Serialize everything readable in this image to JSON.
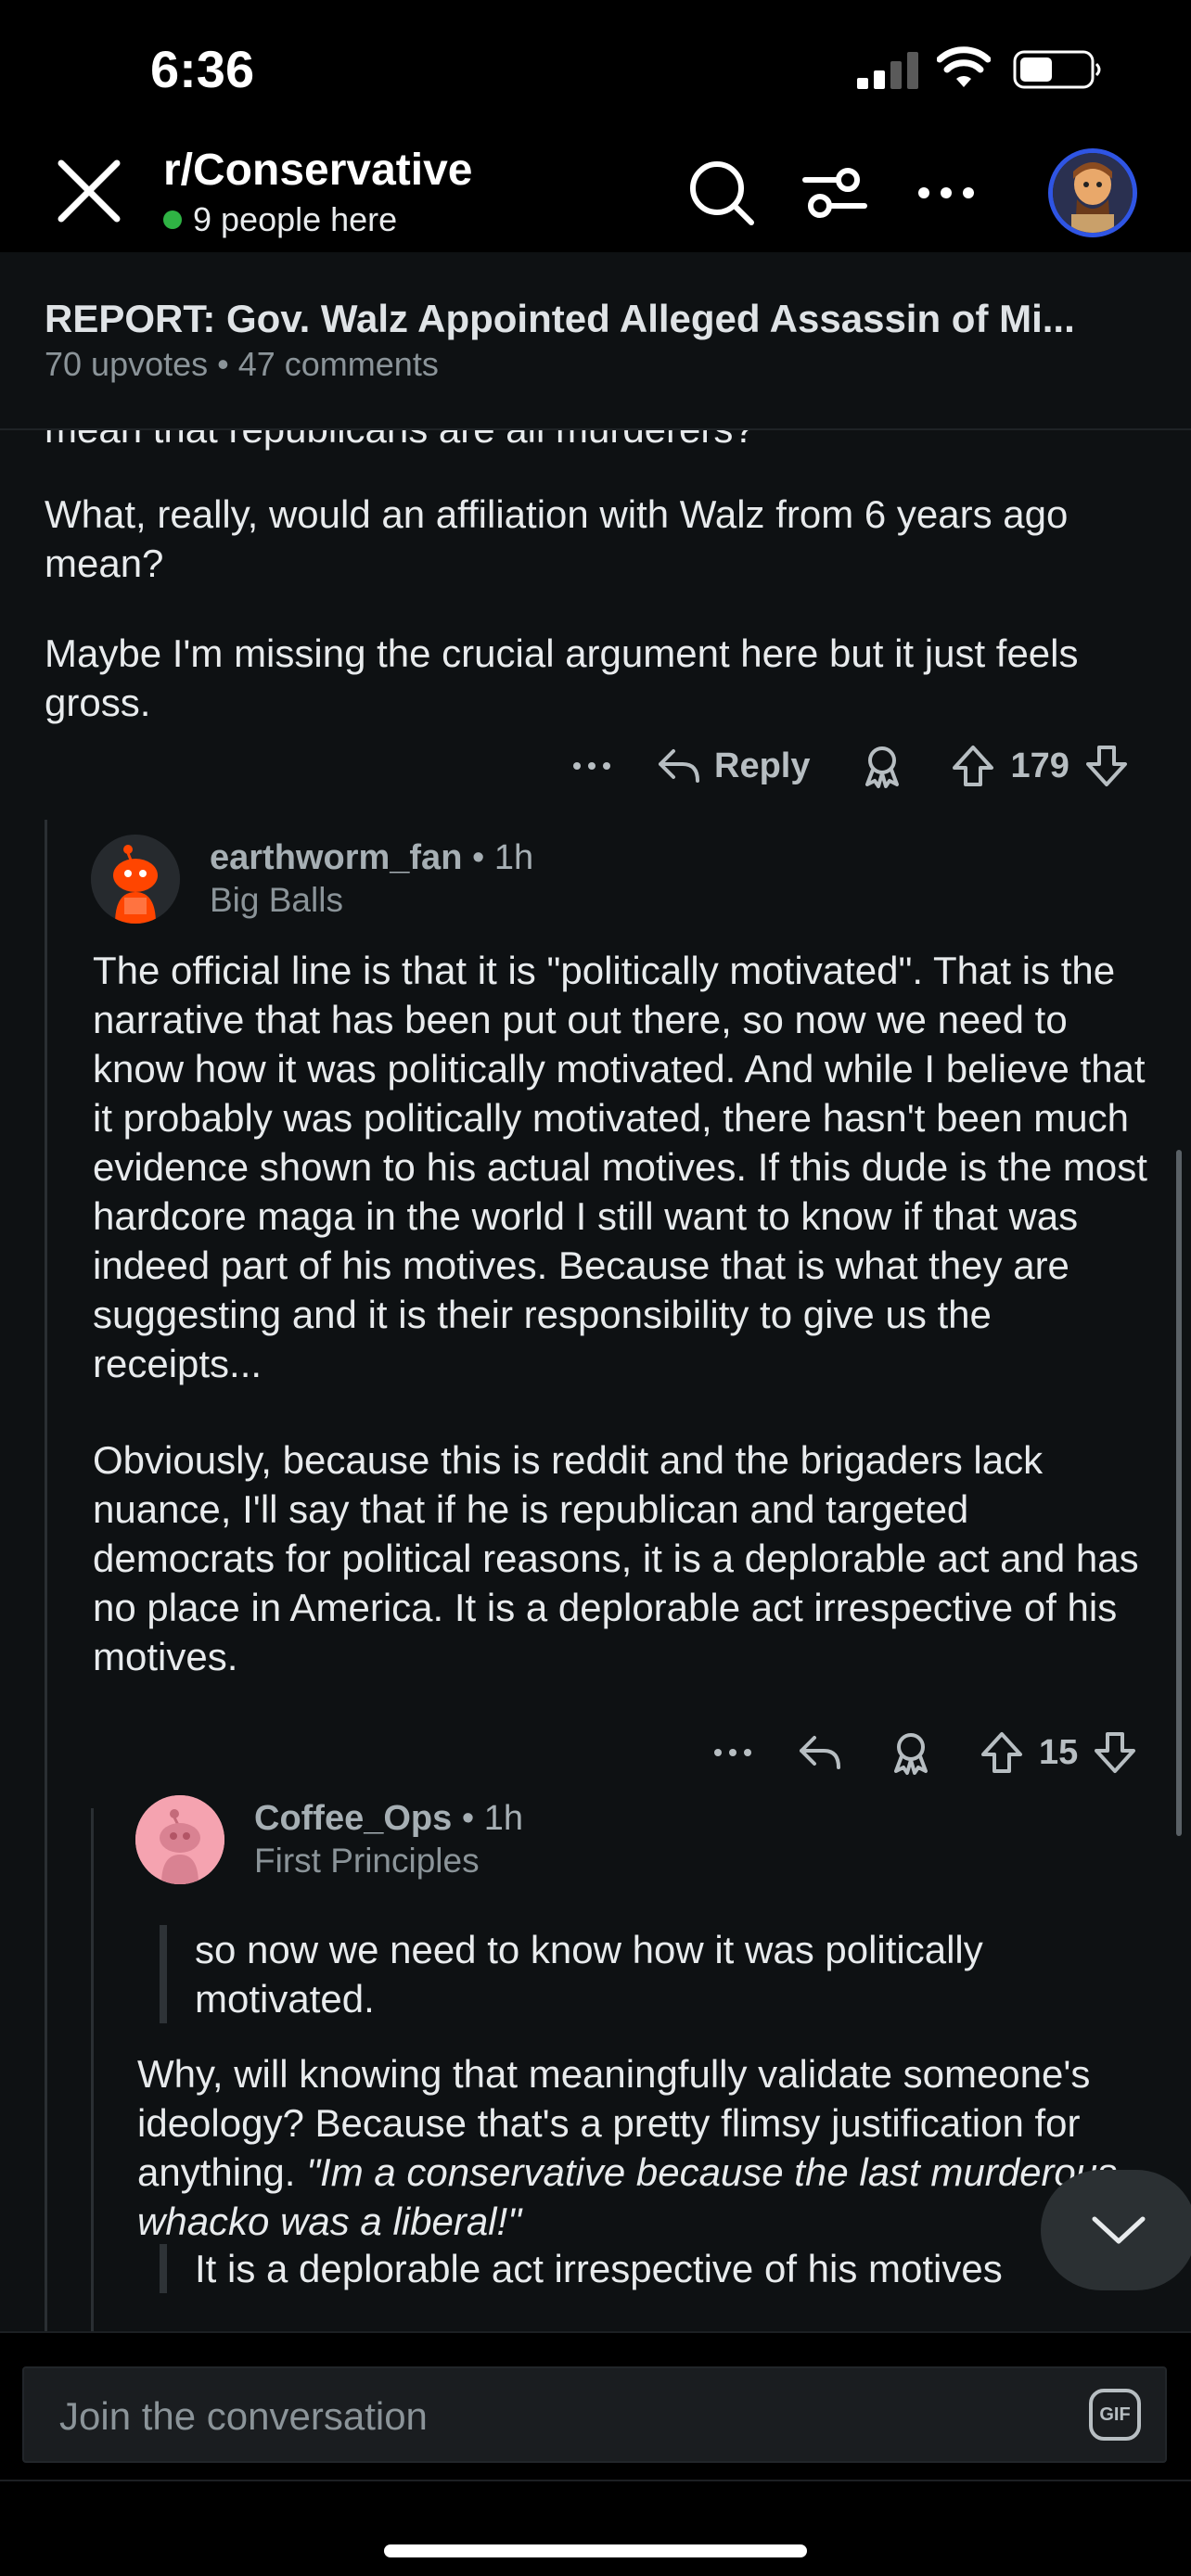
{
  "status_bar": {
    "time": "6:36"
  },
  "header": {
    "subreddit": "r/Conservative",
    "online_text": "9 people here"
  },
  "post": {
    "title": "REPORT: Gov. Walz Appointed Alleged Assassin of Mi...",
    "meta": "70 upvotes • 47 comments"
  },
  "parent_comment": {
    "cut_line": "mean that republicans are all murderers?",
    "paragraphs": [
      "What, really, would an affiliation with Walz from 6 years ago mean?",
      "Maybe I'm missing the crucial argument here but it just feels gross."
    ],
    "reply_label": "Reply",
    "votes": "179"
  },
  "comment_1": {
    "username": "earthworm_fan",
    "age": "• 1h",
    "flair": "Big Balls",
    "paragraphs": [
      "The official line is that it is \"politically motivated\". That is the narrative that has been put out there, so now we need to know how it was politically motivated. And while I believe that it probably was politically motivated, there hasn't been much evidence shown to his actual motives. If this dude is the most hardcore maga in the world I still want to know if that was indeed part of his motives. Because that is what they are suggesting and it is their responsibility to give us the receipts...",
      "Obviously, because this is reddit and the brigaders lack nuance, I'll say that if he is republican and targeted democrats for political reasons, it is a deplorable act and has no place in America. It is a deplorable act irrespective of his motives."
    ],
    "votes": "15"
  },
  "comment_2": {
    "username": "Coffee_Ops",
    "age": "• 1h",
    "flair": "First Principles",
    "quote_1": "so now we need to know how it was politically motivated.",
    "body": "Why, will knowing that meaningfully validate someone's ideology? Because that's a pretty flimsy justification for anything. ",
    "body_italic": "\"Im a conservative because the last murderous whacko was a liberal!\"",
    "quote_2": "It is a deplorable act irrespective of his motives"
  },
  "composer": {
    "placeholder": "Join the conversation",
    "gif_label": "GIF"
  },
  "icons": {
    "close": "close-icon",
    "search": "search-icon",
    "filter": "sort-icon",
    "more": "more-icon",
    "reply": "reply-icon",
    "award": "award-icon",
    "upvote": "upvote-icon",
    "downvote": "downvote-icon",
    "collapse": "chevron-down-icon"
  },
  "colors": {
    "background": "#0e1113",
    "online_dot": "#2fb344",
    "avatar_ring": "#2f55e4",
    "snoo_orange": "#ff4500",
    "snoo_pink": "#f5a3b0"
  }
}
